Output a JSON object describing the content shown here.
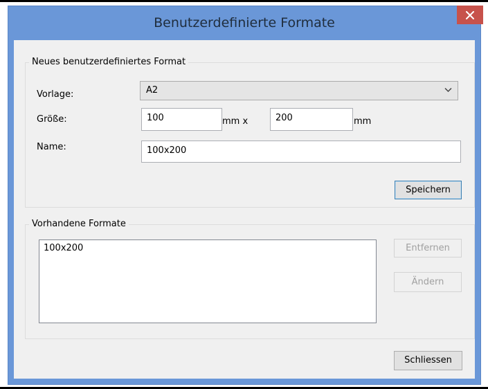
{
  "window": {
    "title": "Benutzerdefinierte Formate",
    "close_icon": "close-icon"
  },
  "new_format": {
    "legend": "Neues benutzerdefiniertes Format",
    "template_label": "Vorlage:",
    "template_value": "A2",
    "size_label": "Größe:",
    "width_value": "100",
    "width_unit": "mm x",
    "height_value": "200",
    "height_unit": "mm",
    "name_label": "Name:",
    "name_value": "100x200",
    "save_label": "Speichern"
  },
  "existing": {
    "legend": "Vorhandene Formate",
    "items": [
      "100x200"
    ],
    "remove_label": "Entfernen",
    "edit_label": "Ändern"
  },
  "footer": {
    "close_label": "Schliessen"
  },
  "colors": {
    "titlebar": "#6a97d8",
    "close_button": "#c7524b",
    "client_background": "#f0f0f0"
  }
}
